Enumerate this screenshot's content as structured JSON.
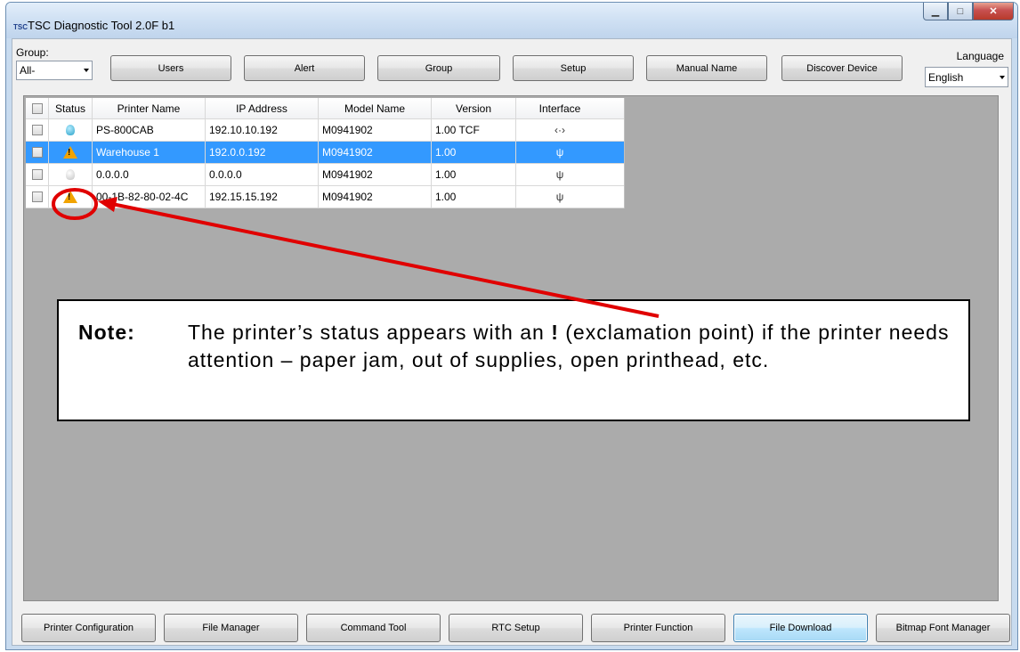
{
  "window": {
    "title": "TSC Diagnostic Tool 2.0F b1",
    "logo": "TSC",
    "controls": [
      "minimize-icon",
      "maximize-icon",
      "close-icon"
    ]
  },
  "toolbar": {
    "group_label": "Group:",
    "group_value": "All-",
    "buttons": [
      "Users",
      "Alert",
      "Group",
      "Setup",
      "Manual Name",
      "Discover Device"
    ],
    "language_label": "Language",
    "language_value": "English"
  },
  "table": {
    "columns": [
      "",
      "Status",
      "Printer Name",
      "IP Address",
      "Model Name",
      "Version",
      "Interface"
    ],
    "rows": [
      {
        "status_icon": "bulb-icon",
        "printer_name": "PS-800CAB",
        "ip": "192.10.10.192",
        "model": "M0941902",
        "version": "1.00  TCF",
        "interface_icon": "ethernet-icon",
        "interface_glyph": "‹·›",
        "selected": false
      },
      {
        "status_icon": "warning-icon",
        "printer_name": "Warehouse 1",
        "ip": "192.0.0.192",
        "model": "M0941902",
        "version": "1.00",
        "interface_icon": "usb-icon",
        "interface_glyph": "ψ",
        "selected": true
      },
      {
        "status_icon": "bulb-off-icon",
        "printer_name": "0.0.0.0",
        "ip": "0.0.0.0",
        "model": "M0941902",
        "version": "1.00",
        "interface_icon": "usb-icon",
        "interface_glyph": "ψ",
        "selected": false
      },
      {
        "status_icon": "warning-icon",
        "printer_name": "00-1B-82-80-02-4C",
        "ip": "192.15.15.192",
        "model": "M0941902",
        "version": "1.00",
        "interface_icon": "usb-icon",
        "interface_glyph": "ψ",
        "selected": false
      }
    ]
  },
  "note": {
    "label": "Note:",
    "text_before": "The printer’s status appears with an ",
    "text_bold": "!",
    "text_after": " (exclamation point) if the printer needs attention – paper jam, out of supplies, open printhead, etc."
  },
  "bottom_buttons": [
    "Printer Configuration",
    "File Manager",
    "Command Tool",
    "RTC Setup",
    "Printer Function",
    "File Download",
    "Bitmap Font Manager"
  ],
  "colors": {
    "selection": "#3399ff",
    "callout": "#e00000",
    "warning": "#f1a300",
    "panel": "#ababab"
  }
}
